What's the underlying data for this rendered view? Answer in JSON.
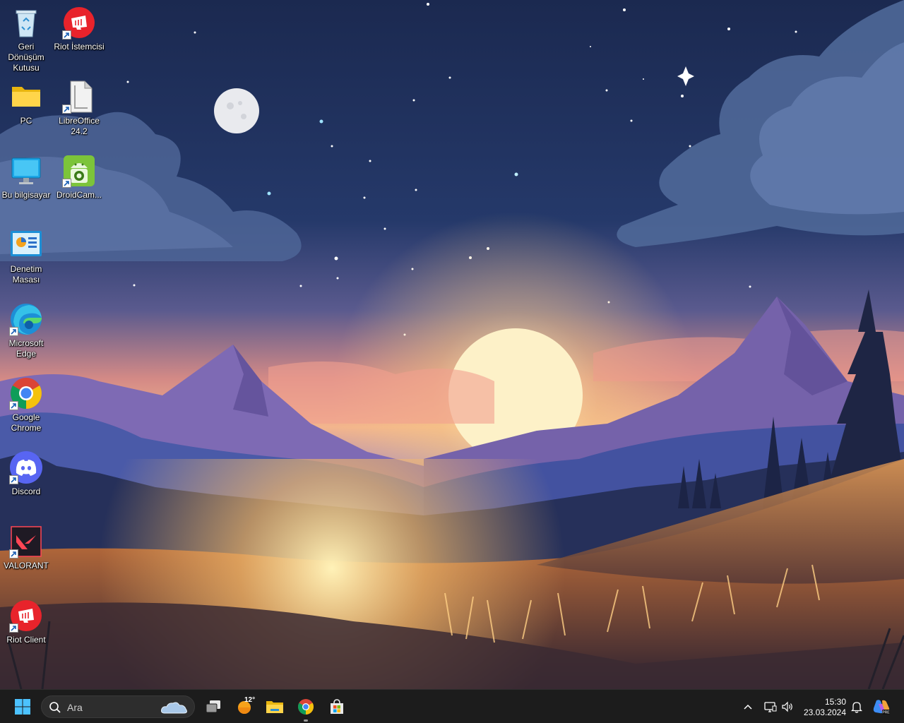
{
  "desktop": {
    "icons": [
      {
        "label": "Geri\nDönüşüm\nKutusu",
        "icon": "recycle-bin-icon"
      },
      {
        "label": "Riot İstemcisi",
        "icon": "riot-client-icon"
      },
      {
        "label": "PC",
        "icon": "folder-icon"
      },
      {
        "label": "LibreOffice\n24.2",
        "icon": "libreoffice-icon"
      },
      {
        "label": "Bu bilgisayar",
        "icon": "this-pc-icon"
      },
      {
        "label": "DroidCam...",
        "icon": "droidcam-icon"
      },
      {
        "label": "Denetim\nMasası",
        "icon": "control-panel-icon"
      },
      {
        "label": "Microsoft\nEdge",
        "icon": "edge-icon"
      },
      {
        "label": "Google\nChrome",
        "icon": "chrome-icon"
      },
      {
        "label": "Discord",
        "icon": "discord-icon"
      },
      {
        "label": "VALORANT",
        "icon": "valorant-icon"
      },
      {
        "label": "Riot Client",
        "icon": "riot-client-icon"
      }
    ]
  },
  "taskbar": {
    "search_placeholder": "Ara",
    "weather_temp": "12°",
    "clock_time": "15:30",
    "clock_date": "23.03.2024",
    "pinned": [
      "start-icon",
      "task-view-icon",
      "weather-icon",
      "file-explorer-icon",
      "chrome-icon",
      "store-icon"
    ],
    "tray": [
      "chevron-up-icon",
      "network-icon",
      "volume-icon",
      "notification-bell-icon",
      "copilot-icon"
    ]
  },
  "colors": {
    "taskbar_bg": "#1c1c1c",
    "riot_red": "#e8232b",
    "discord": "#5865f2",
    "edge_blue": "#1d8fd6"
  }
}
